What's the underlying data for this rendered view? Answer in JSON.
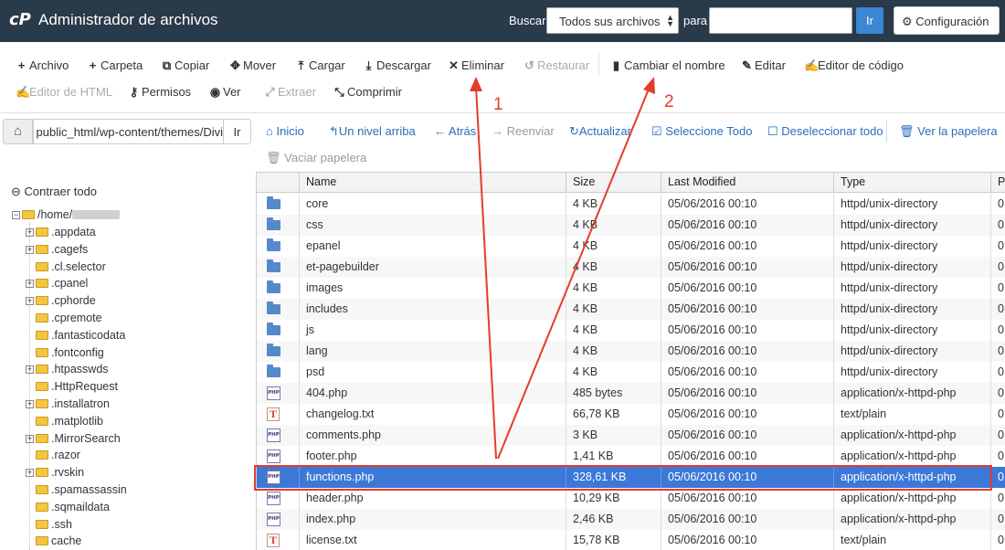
{
  "header": {
    "logo_text": "cP",
    "title": "Administrador de archivos",
    "search_label": "Buscar",
    "search_scope": "Todos sus archivos",
    "for_label": "para",
    "search_value": "",
    "go_label": "Ir",
    "settings_label": "Configuración",
    "background_color": "#293a4a"
  },
  "toolbar": {
    "file": "Archivo",
    "folder": "Carpeta",
    "copy": "Copiar",
    "move": "Mover",
    "upload": "Cargar",
    "download": "Descargar",
    "delete": "Eliminar",
    "restore": "Restaurar",
    "rename": "Cambiar el nombre",
    "edit": "Editar",
    "code_editor": "Editor de código",
    "html_editor": "Editor de HTML",
    "permissions": "Permisos",
    "view": "Ver",
    "extract": "Extraer",
    "compress": "Comprimir"
  },
  "sidebar": {
    "path_value": "public_html/wp-content/themes/Divi",
    "path_go": "Ir",
    "collapse_all": "Contraer todo",
    "root": "/home/",
    "items": [
      {
        "label": ".appdata",
        "expandable": true
      },
      {
        "label": ".cagefs",
        "expandable": true
      },
      {
        "label": ".cl.selector",
        "expandable": false
      },
      {
        "label": ".cpanel",
        "expandable": true
      },
      {
        "label": ".cphorde",
        "expandable": true
      },
      {
        "label": ".cpremote",
        "expandable": false
      },
      {
        "label": ".fantasticodata",
        "expandable": false
      },
      {
        "label": ".fontconfig",
        "expandable": false
      },
      {
        "label": ".htpasswds",
        "expandable": true
      },
      {
        "label": ".HttpRequest",
        "expandable": false
      },
      {
        "label": ".installatron",
        "expandable": true
      },
      {
        "label": ".matplotlib",
        "expandable": false
      },
      {
        "label": ".MirrorSearch",
        "expandable": true
      },
      {
        "label": ".razor",
        "expandable": false
      },
      {
        "label": ".rvskin",
        "expandable": true
      },
      {
        "label": ".spamassassin",
        "expandable": false
      },
      {
        "label": ".sqmaildata",
        "expandable": false
      },
      {
        "label": ".ssh",
        "expandable": false
      },
      {
        "label": "cache",
        "expandable": false
      }
    ]
  },
  "nav": {
    "home": "Inicio",
    "up_one_level": "Un nivel arriba",
    "back": "Atrás",
    "forward": "Reenviar",
    "reload": "Actualizar",
    "select_all": "Seleccione Todo",
    "deselect_all": "Deseleccionar todo",
    "view_trash": "Ver la papelera",
    "empty_trash": "Vaciar papelera"
  },
  "table": {
    "columns": {
      "name": "Name",
      "size": "Size",
      "modified": "Last Modified",
      "type": "Type",
      "perms": "Pe"
    },
    "rows": [
      {
        "icon": "folder",
        "name": "core",
        "size": "4 KB",
        "modified": "05/06/2016 00:10",
        "type": "httpd/unix-directory",
        "perms": "0"
      },
      {
        "icon": "folder",
        "name": "css",
        "size": "4 KB",
        "modified": "05/06/2016 00:10",
        "type": "httpd/unix-directory",
        "perms": "0"
      },
      {
        "icon": "folder",
        "name": "epanel",
        "size": "4 KB",
        "modified": "05/06/2016 00:10",
        "type": "httpd/unix-directory",
        "perms": "0"
      },
      {
        "icon": "folder",
        "name": "et-pagebuilder",
        "size": "4 KB",
        "modified": "05/06/2016 00:10",
        "type": "httpd/unix-directory",
        "perms": "0"
      },
      {
        "icon": "folder",
        "name": "images",
        "size": "4 KB",
        "modified": "05/06/2016 00:10",
        "type": "httpd/unix-directory",
        "perms": "0"
      },
      {
        "icon": "folder",
        "name": "includes",
        "size": "4 KB",
        "modified": "05/06/2016 00:10",
        "type": "httpd/unix-directory",
        "perms": "0"
      },
      {
        "icon": "folder",
        "name": "js",
        "size": "4 KB",
        "modified": "05/06/2016 00:10",
        "type": "httpd/unix-directory",
        "perms": "0"
      },
      {
        "icon": "folder",
        "name": "lang",
        "size": "4 KB",
        "modified": "05/06/2016 00:10",
        "type": "httpd/unix-directory",
        "perms": "0"
      },
      {
        "icon": "folder",
        "name": "psd",
        "size": "4 KB",
        "modified": "05/06/2016 00:10",
        "type": "httpd/unix-directory",
        "perms": "0"
      },
      {
        "icon": "php",
        "name": "404.php",
        "size": "485 bytes",
        "modified": "05/06/2016 00:10",
        "type": "application/x-httpd-php",
        "perms": "0"
      },
      {
        "icon": "txt",
        "name": "changelog.txt",
        "size": "66,78 KB",
        "modified": "05/06/2016 00:10",
        "type": "text/plain",
        "perms": "0"
      },
      {
        "icon": "php",
        "name": "comments.php",
        "size": "3 KB",
        "modified": "05/06/2016 00:10",
        "type": "application/x-httpd-php",
        "perms": "0"
      },
      {
        "icon": "php",
        "name": "footer.php",
        "size": "1,41 KB",
        "modified": "05/06/2016 00:10",
        "type": "application/x-httpd-php",
        "perms": "0"
      },
      {
        "icon": "php",
        "name": "functions.php",
        "size": "328,61 KB",
        "modified": "05/06/2016 00:10",
        "type": "application/x-httpd-php",
        "perms": "0",
        "selected": true
      },
      {
        "icon": "php",
        "name": "header.php",
        "size": "10,29 KB",
        "modified": "05/06/2016 00:10",
        "type": "application/x-httpd-php",
        "perms": "0"
      },
      {
        "icon": "php",
        "name": "index.php",
        "size": "2,46 KB",
        "modified": "05/06/2016 00:10",
        "type": "application/x-httpd-php",
        "perms": "0"
      },
      {
        "icon": "txt",
        "name": "license.txt",
        "size": "15,78 KB",
        "modified": "05/06/2016 00:10",
        "type": "text/plain",
        "perms": "0"
      }
    ]
  },
  "annotations": {
    "label_1": "1",
    "label_2": "2",
    "color": "#e53b2c"
  },
  "colors": {
    "selection": "#3b78d8",
    "link": "#2a6ebb",
    "folder_tree": "#f4c542"
  }
}
